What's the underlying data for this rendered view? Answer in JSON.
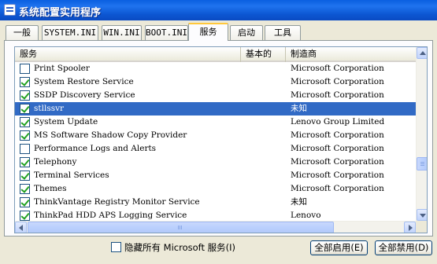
{
  "window": {
    "title": "系统配置实用程序"
  },
  "tabs": [
    {
      "label": "一般",
      "active": false
    },
    {
      "label": "SYSTEM.INI",
      "active": false
    },
    {
      "label": "WIN.INI",
      "active": false
    },
    {
      "label": "BOOT.INI",
      "active": false
    },
    {
      "label": "服务",
      "active": true
    },
    {
      "label": "启动",
      "active": false
    },
    {
      "label": "工具",
      "active": false
    }
  ],
  "services": {
    "columns": {
      "name": "服务",
      "essential": "基本的",
      "manufacturer": "制造商"
    },
    "rows": [
      {
        "name": "Print Spooler",
        "manufacturer": "Microsoft Corporation",
        "checked": false,
        "selected": false
      },
      {
        "name": "System Restore Service",
        "manufacturer": "Microsoft Corporation",
        "checked": true,
        "selected": false
      },
      {
        "name": "SSDP Discovery Service",
        "manufacturer": "Microsoft Corporation",
        "checked": true,
        "selected": false
      },
      {
        "name": "stllssvr",
        "manufacturer": "未知",
        "checked": true,
        "selected": true
      },
      {
        "name": "System Update",
        "manufacturer": "Lenovo Group Limited",
        "checked": true,
        "selected": false
      },
      {
        "name": "MS Software Shadow Copy Provider",
        "manufacturer": "Microsoft Corporation",
        "checked": true,
        "selected": false
      },
      {
        "name": "Performance Logs and Alerts",
        "manufacturer": "Microsoft Corporation",
        "checked": false,
        "selected": false
      },
      {
        "name": "Telephony",
        "manufacturer": "Microsoft Corporation",
        "checked": true,
        "selected": false
      },
      {
        "name": "Terminal Services",
        "manufacturer": "Microsoft Corporation",
        "checked": true,
        "selected": false
      },
      {
        "name": "Themes",
        "manufacturer": "Microsoft Corporation",
        "checked": true,
        "selected": false
      },
      {
        "name": "ThinkVantage Registry Monitor Service",
        "manufacturer": "未知",
        "checked": true,
        "selected": false
      },
      {
        "name": "ThinkPad HDD APS Logging Service",
        "manufacturer": "Lenovo",
        "checked": true,
        "selected": false
      }
    ]
  },
  "footer": {
    "hide_ms_label": "隐藏所有 Microsoft 服务(I)",
    "hide_ms_checked": false,
    "enable_all_label": "全部启用(E)",
    "disable_all_label": "全部禁用(D)"
  },
  "colors": {
    "title_bar": "#0a5fe0",
    "selection": "#316ac5",
    "active_tab_accent": "#ffc83c"
  }
}
